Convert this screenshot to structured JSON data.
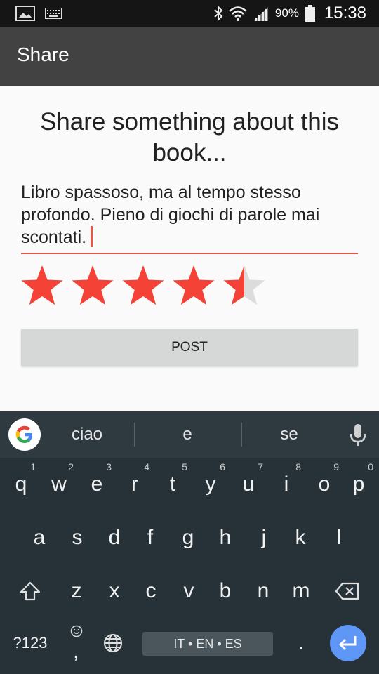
{
  "status_bar": {
    "battery_pct": "90%",
    "time": "15:38",
    "icons": [
      "image-icon",
      "keyboard-icon",
      "bluetooth-icon",
      "wifi-icon",
      "signal-icon",
      "battery-icon"
    ]
  },
  "app_bar": {
    "title": "Share"
  },
  "main": {
    "heading_line1": "Share something about this",
    "heading_line2": "book...",
    "review_text": "Libro spassoso, ma al tempo stesso profondo. Pieno di giochi di parole mai scontati.",
    "rating": 4.5,
    "rating_max": 5,
    "post_label": "POST"
  },
  "keyboard": {
    "suggestions": [
      "ciao",
      "e",
      "se"
    ],
    "row1": [
      {
        "key": "q",
        "hint": "1"
      },
      {
        "key": "w",
        "hint": "2"
      },
      {
        "key": "e",
        "hint": "3"
      },
      {
        "key": "r",
        "hint": "4"
      },
      {
        "key": "t",
        "hint": "5"
      },
      {
        "key": "y",
        "hint": "6"
      },
      {
        "key": "u",
        "hint": "7"
      },
      {
        "key": "i",
        "hint": "8"
      },
      {
        "key": "o",
        "hint": "9"
      },
      {
        "key": "p",
        "hint": "0"
      }
    ],
    "row2": [
      "a",
      "s",
      "d",
      "f",
      "g",
      "h",
      "j",
      "k",
      "l"
    ],
    "row3": [
      "z",
      "x",
      "c",
      "v",
      "b",
      "n",
      "m"
    ],
    "symbols_label": "?123",
    "comma": ",",
    "space_label": "IT • EN • ES",
    "period": ".",
    "colors": {
      "accent": "#e2574c",
      "star": "#f44336",
      "enter": "#5e97f6"
    }
  }
}
